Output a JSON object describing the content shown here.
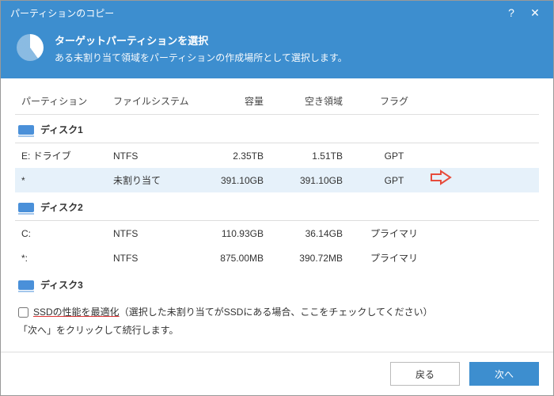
{
  "window_title": "パーティションのコピー",
  "header": {
    "title": "ターゲットパーティションを選択",
    "subtitle": "ある未割り当て領域をパーティションの作成場所として選択します。"
  },
  "columns": {
    "partition": "パーティション",
    "filesystem": "ファイルシステム",
    "capacity": "容量",
    "free": "空き領域",
    "flag": "フラグ"
  },
  "disks": [
    {
      "name": "ディスク1",
      "rows": [
        {
          "part": "E: ドライブ",
          "fs": "NTFS",
          "cap": "2.35TB",
          "free": "1.51TB",
          "flag": "GPT",
          "selected": false
        },
        {
          "part": "*",
          "fs": "未割り当て",
          "cap": "391.10GB",
          "free": "391.10GB",
          "flag": "GPT",
          "selected": true
        }
      ]
    },
    {
      "name": "ディスク2",
      "rows": [
        {
          "part": "C:",
          "fs": "NTFS",
          "cap": "110.93GB",
          "free": "36.14GB",
          "flag": "プライマリ",
          "selected": false
        },
        {
          "part": "*:",
          "fs": "NTFS",
          "cap": "875.00MB",
          "free": "390.72MB",
          "flag": "プライマリ",
          "selected": false
        }
      ]
    },
    {
      "name": "ディスク3",
      "rows": []
    }
  ],
  "options": {
    "ssd_prefix": "SSDの性能を最適化",
    "ssd_suffix": "（選択した未割り当てがSSDにある場合、ここをチェックしてください）",
    "hint": "「次へ」をクリックして続行します。"
  },
  "footer": {
    "back": "戻る",
    "next": "次へ"
  }
}
